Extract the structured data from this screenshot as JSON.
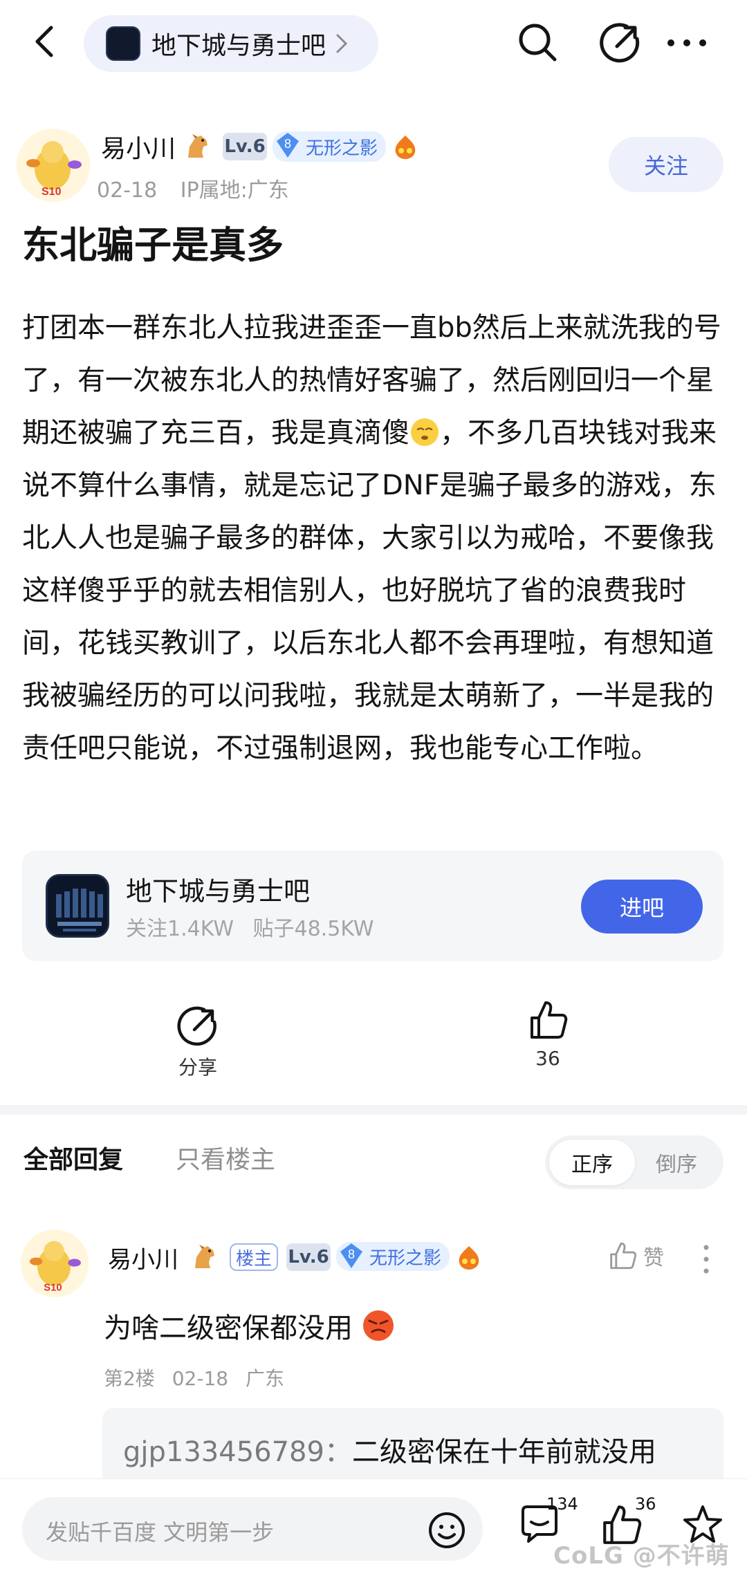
{
  "topbar": {
    "forum_name": "地下城与勇士吧",
    "icons": [
      "back-icon",
      "search-icon",
      "share-icon",
      "more-icon"
    ]
  },
  "author": {
    "name": "易小川",
    "level": "Lv.6",
    "title_num": "8",
    "title": "无形之影",
    "date": "02-18",
    "ip": "IP属地:广东",
    "follow_label": "关注"
  },
  "post": {
    "title": "东北骗子是真多",
    "body_part1": "打团本一群东北人拉我进歪歪一直bb然后上来就洗我的号了，有一次被东北人的热情好客骗了，然后刚回归一个星期还被骗了充三百，我是真滴傻",
    "body_part2": "，不多几百块钱对我来说不算什么事情，就是忘记了DNF是骗子最多的游戏，东北人人也是骗子最多的群体，大家引以为戒哈，不要像我这样傻乎乎的就去相信别人，也好脱坑了省的浪费我时间，花钱买教训了，以后东北人都不会再理啦，有想知道我被骗经历的可以问我啦，我就是太萌新了，一半是我的责任吧只能说，不过强制退网，我也能专心工作啦。"
  },
  "forum_card": {
    "name": "地下城与勇士吧",
    "followers": "关注1.4KW",
    "posts": "贴子48.5KW",
    "enter_label": "进吧"
  },
  "actions": {
    "share_label": "分享",
    "like_count": "36"
  },
  "reply_tabs": {
    "all": "全部回复",
    "owner_only": "只看楼主",
    "order_asc": "正序",
    "order_desc": "倒序"
  },
  "reply": {
    "name": "易小川",
    "owner_badge": "楼主",
    "level": "Lv.6",
    "title_num": "8",
    "title": "无形之影",
    "like_label": "赞",
    "text": "为啥二级密保都没用",
    "floor": "第2楼",
    "date": "02-18",
    "location": "广东",
    "subreply_user": "gjp133456789：",
    "subreply_text": "二级密保在十年前就没用"
  },
  "bottombar": {
    "input_placeholder": "发贴千百度 文明第一步",
    "comment_count": "134",
    "like_count": "36"
  },
  "watermark": "CoLG @不许萌",
  "colors": {
    "accent": "#4366e8",
    "pill_bg": "#eef0fb",
    "follow_text": "#4768d8",
    "level_badge": "#dde3ee",
    "title_badge": "#e6f0ff"
  }
}
